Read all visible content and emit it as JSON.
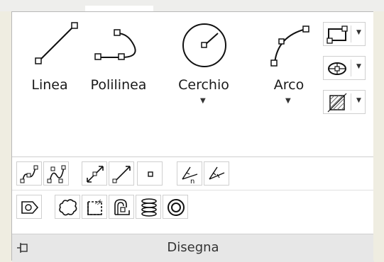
{
  "panel": {
    "title": "Disegna",
    "large_tools": [
      {
        "label": "Linea",
        "icon": "line-icon"
      },
      {
        "label": "Polilinea",
        "icon": "polyline-icon"
      },
      {
        "label": "Cerchio",
        "icon": "circle-icon",
        "has_dropdown": true
      },
      {
        "label": "Arco",
        "icon": "arc-icon",
        "has_dropdown": true
      }
    ],
    "right_tools": [
      {
        "icon": "rectangle-icon",
        "has_dropdown": true
      },
      {
        "icon": "ellipse-icon",
        "has_dropdown": true
      },
      {
        "icon": "hatch-icon",
        "has_dropdown": true
      }
    ],
    "row1_tools": [
      "spline-fit-icon",
      "spline-cv-icon",
      "construction-line-icon",
      "ray-icon",
      "point-icon",
      "divide-icon",
      "measure-icon"
    ],
    "row2_tools": [
      "region-icon",
      "revision-cloud-icon",
      "wipeout-icon",
      "boundary-icon",
      "helix-icon",
      "donut-icon"
    ]
  },
  "colors": {
    "accent": "#000000",
    "panel_bg": "#ffffff",
    "footer_bg": "#e7e7e7"
  }
}
